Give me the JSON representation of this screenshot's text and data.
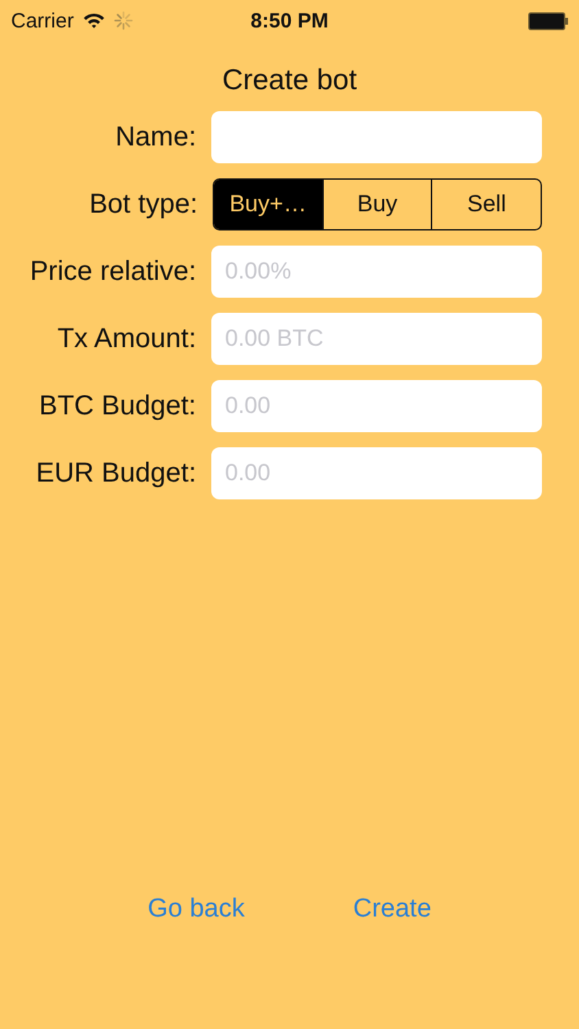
{
  "status_bar": {
    "carrier": "Carrier",
    "time": "8:50 PM"
  },
  "title": "Create bot",
  "form": [
    {
      "kind": "text",
      "label": "Name:"
    },
    {
      "kind": "segmented",
      "label": "Bot type:",
      "segments": [
        {
          "label": "Buy+…",
          "selected": true
        },
        {
          "label": "Buy",
          "selected": false
        },
        {
          "label": "Sell",
          "selected": false
        }
      ]
    },
    {
      "kind": "text",
      "label": "Price relative:",
      "placeholder": "0.00%"
    },
    {
      "kind": "text",
      "label": "Tx Amount:",
      "placeholder": "0.00 BTC"
    },
    {
      "kind": "text",
      "label": "BTC Budget:",
      "placeholder": "0.00"
    },
    {
      "kind": "text",
      "label": "EUR Budget:",
      "placeholder": "0.00"
    }
  ],
  "buttons": [
    "Go back",
    "Create"
  ]
}
